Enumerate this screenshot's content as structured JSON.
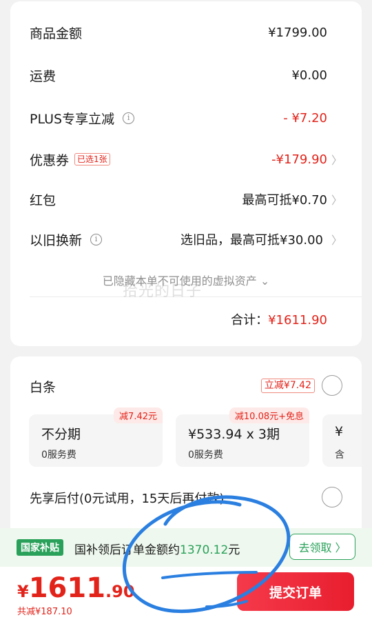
{
  "summary": {
    "goods_amount": {
      "label": "商品金额",
      "value": "¥1799.00"
    },
    "shipping": {
      "label": "运费",
      "value": "¥0.00"
    },
    "plus_discount": {
      "label": "PLUS专享立减",
      "value": "- ¥7.20"
    },
    "coupon": {
      "label": "优惠券",
      "tag": "已选1张",
      "value": "-¥179.90"
    },
    "red_packet": {
      "label": "红包",
      "value": "最高可抵¥0.70"
    },
    "trade_in": {
      "label": "以旧换新",
      "value": "选旧品，最高可抵¥30.00"
    },
    "hidden_assets": "已隐藏本单不可使用的虚拟资产 ⌄",
    "watermark": "拾光的日子",
    "total_label": "合计：",
    "total_value": "¥1611.90"
  },
  "payment": {
    "baitiao_label": "白条",
    "baitiao_tag": "立减¥7.42",
    "plans": [
      {
        "title": "不分期",
        "sub": "0服务费",
        "badge": "减7.42元"
      },
      {
        "title": "¥533.94 x 3期",
        "sub": "0服务费",
        "badge": "减10.08元+免息"
      },
      {
        "title": "¥",
        "sub": "含"
      }
    ],
    "pay_later_label": "先享后付(0元试用，15天后再付款)"
  },
  "subsidy": {
    "badge": "国家补贴",
    "text": "国补领后订单金额约",
    "amount": "1370.12",
    "unit": "元",
    "claim_label": "去领取 〉"
  },
  "footer": {
    "currency": "¥",
    "price_int": "1611",
    "price_dec": ".90",
    "saved": "共减¥187.10",
    "submit_label": "提交订单"
  },
  "colors": {
    "accent_red": "#e2231a",
    "subsidy_green": "#2aa15a",
    "annotation_blue": "#2a7fe0"
  },
  "icons": [
    "info-icon",
    "chevron-right-icon",
    "radio-icon",
    "hand-drawn-circle-annotation"
  ]
}
